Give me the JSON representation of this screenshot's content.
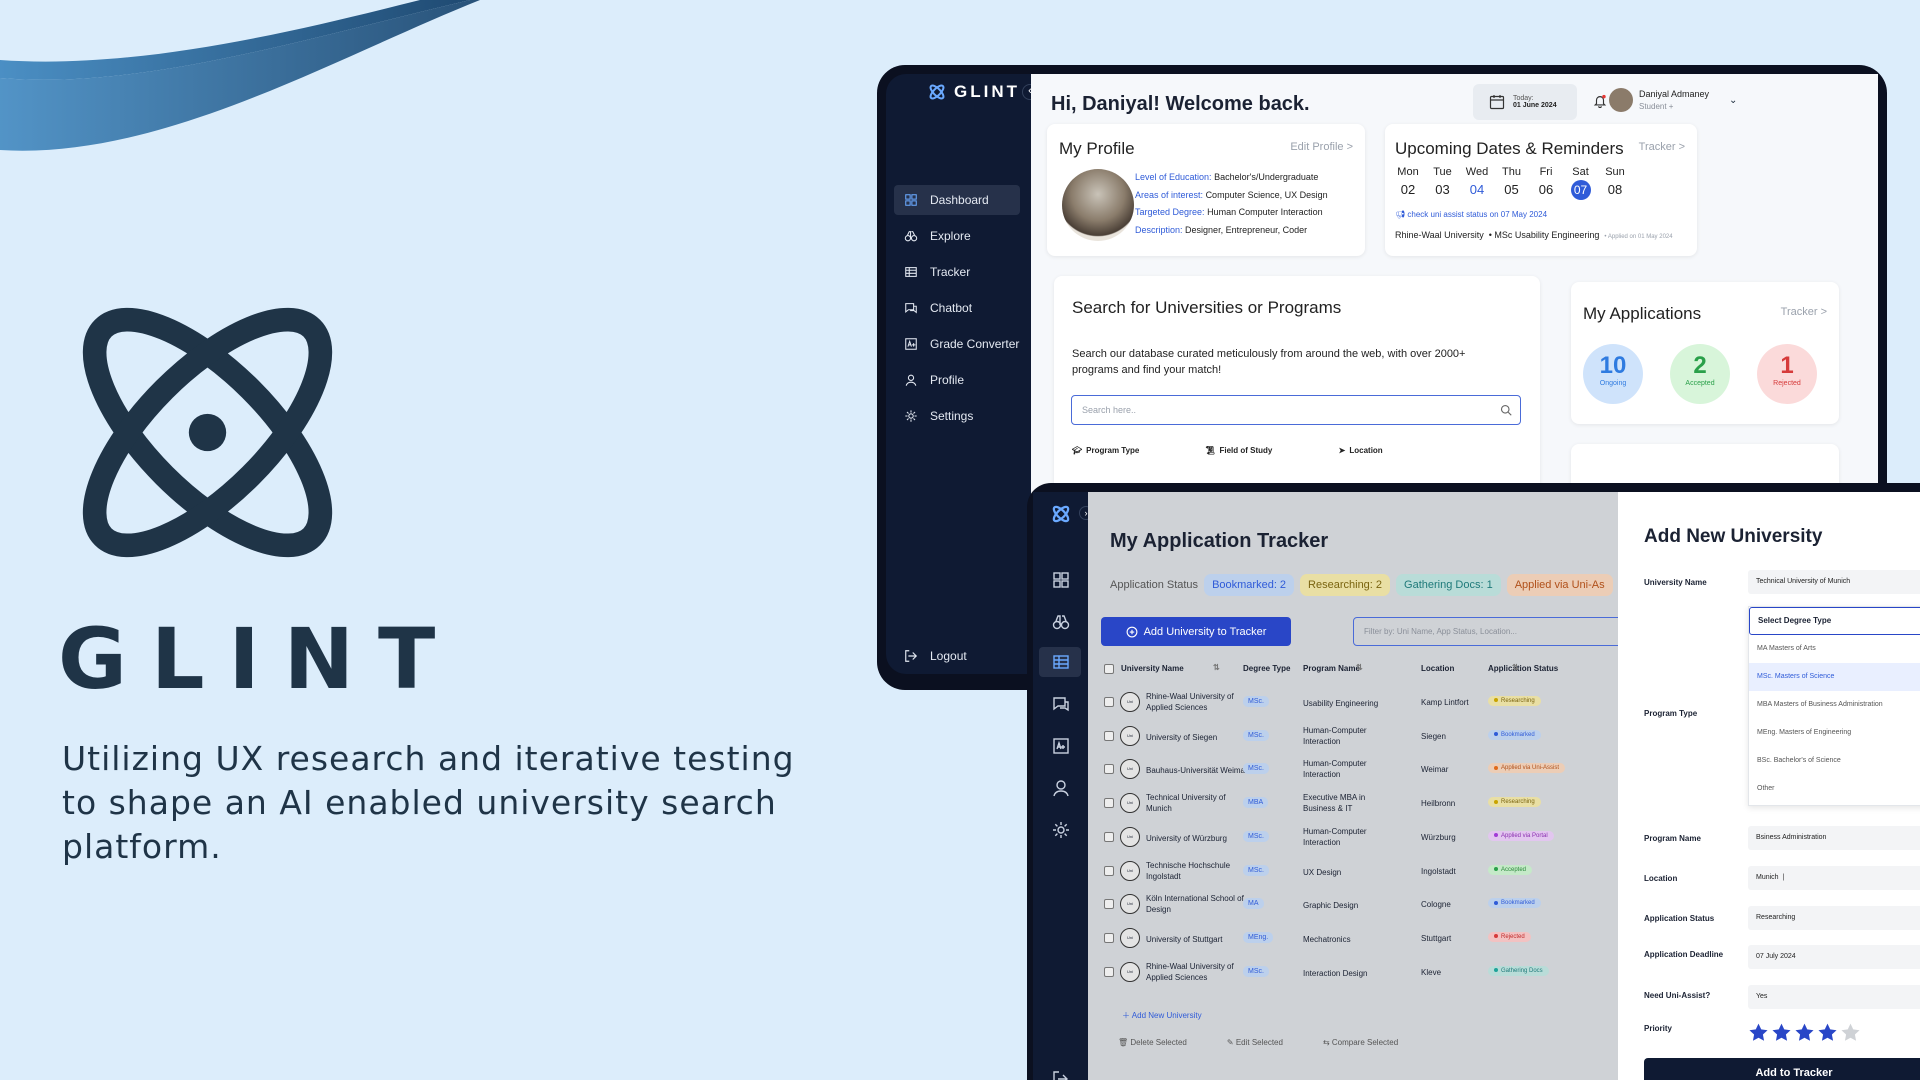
{
  "brand": {
    "name": "GLINT",
    "tagline": "Utilizing UX research and iterative testing to shape an AI enabled university search platform.",
    "color": "#1f3447"
  },
  "dashboard": {
    "logo": "GLINT",
    "nav": [
      {
        "label": "Dashboard",
        "icon": "grid-icon",
        "active": true
      },
      {
        "label": "Explore",
        "icon": "binoculars-icon"
      },
      {
        "label": "Tracker",
        "icon": "table-icon"
      },
      {
        "label": "Chatbot",
        "icon": "chat-icon"
      },
      {
        "label": "Grade Converter",
        "icon": "grade-icon"
      },
      {
        "label": "Profile",
        "icon": "user-icon"
      },
      {
        "label": "Settings",
        "icon": "gear-icon"
      }
    ],
    "logout": "Logout",
    "greeting": "Hi, Daniyal! Welcome back.",
    "today_label": "Today:",
    "today_date": "01 June 2024",
    "user_name": "Daniyal Admaney",
    "user_role": "Student +",
    "profile": {
      "title": "My Profile",
      "edit": "Edit Profile >",
      "rows": [
        {
          "k": "Level of Education:",
          "v": "Bachelor's/Undergraduate"
        },
        {
          "k": "Areas of interest:",
          "v": "Computer Science, UX Design"
        },
        {
          "k": "Targeted Degree:",
          "v": "Human Computer Interaction"
        },
        {
          "k": "Description:",
          "v": "Designer, Entrepreneur, Coder"
        }
      ]
    },
    "dates": {
      "title": "Upcoming Dates & Reminders",
      "link": "Tracker >",
      "days": [
        {
          "d": "Mon",
          "n": "02"
        },
        {
          "d": "Tue",
          "n": "03"
        },
        {
          "d": "Wed",
          "n": "04"
        },
        {
          "d": "Thu",
          "n": "05"
        },
        {
          "d": "Fri",
          "n": "06"
        },
        {
          "d": "Sat",
          "n": "07"
        },
        {
          "d": "Sun",
          "n": "08"
        }
      ],
      "reminder": "check uni assist status on 07 May 2024",
      "uni": "Rhine-Waal University",
      "program": "MSc Usability Engineering",
      "applied": "Applied on 01 May 2024"
    },
    "search": {
      "title": "Search for Universities or Programs",
      "desc": "Search our database curated meticulously from around the web, with over 2000+ programs and find your match!",
      "placeholder": "Search here..",
      "filters": [
        "Program Type",
        "Field of Study",
        "Location"
      ]
    },
    "apps": {
      "title": "My Applications",
      "link": "Tracker >",
      "stats": [
        {
          "value": "10",
          "label": "Ongoing",
          "color": "#2f7be0",
          "bg": "#cfe3fb"
        },
        {
          "value": "2",
          "label": "Accepted",
          "color": "#2aa04a",
          "bg": "#d8f5da"
        },
        {
          "value": "1",
          "label": "Rejected",
          "color": "#d63a3a",
          "bg": "#fbdada"
        }
      ]
    }
  },
  "tracker": {
    "title": "My Application Tracker",
    "status_label": "Application Status",
    "pills": [
      {
        "label": "Bookmarked: 2",
        "color": "#2f5bd8",
        "bg": "#bcd0ec"
      },
      {
        "label": "Researching: 2",
        "color": "#7a6410",
        "bg": "#e9dfa4"
      },
      {
        "label": "Gathering Docs: 1",
        "color": "#1f7a7a",
        "bg": "#b9dcd8"
      },
      {
        "label": "Applied via Uni-As",
        "color": "#b0501a",
        "bg": "#eccdb6"
      }
    ],
    "add_button": "Add University to Tracker",
    "filter_placeholder": "Filter by: Uni Name, App Status, Location...",
    "headers": [
      "University Name",
      "Degree Type",
      "Program Name",
      "Location",
      "Application Status"
    ],
    "rows": [
      {
        "uni": [
          "Rhine-Waal University of",
          "Applied Sciences"
        ],
        "deg": "MSc.",
        "prog": [
          "Usability Engineering"
        ],
        "loc": "Kamp Lintfort",
        "status": "Researching"
      },
      {
        "uni": [
          "University of Siegen"
        ],
        "deg": "MSc.",
        "prog": [
          "Human-Computer",
          "Interaction"
        ],
        "loc": "Siegen",
        "status": "Bookmarked"
      },
      {
        "uni": [
          "Bauhaus-Universität Weimar"
        ],
        "deg": "MSc.",
        "prog": [
          "Human-Computer",
          "Interaction"
        ],
        "loc": "Weimar",
        "status": "Applied via Uni-Assist"
      },
      {
        "uni": [
          "Technical University of",
          "Munich"
        ],
        "deg": "MBA",
        "prog": [
          "Executive MBA in",
          "Business & IT"
        ],
        "loc": "Heilbronn",
        "status": "Researching"
      },
      {
        "uni": [
          "University of Würzburg"
        ],
        "deg": "MSc.",
        "prog": [
          "Human-Computer",
          "Interaction"
        ],
        "loc": "Würzburg",
        "status": "Applied via Portal"
      },
      {
        "uni": [
          "Technische Hochschule",
          "Ingolstadt"
        ],
        "deg": "MSc.",
        "prog": [
          "UX Design"
        ],
        "loc": "Ingolstadt",
        "status": "Accepted"
      },
      {
        "uni": [
          "Köln International School of",
          "Design"
        ],
        "deg": "MA",
        "prog": [
          "Graphic Design"
        ],
        "loc": "Cologne",
        "status": "Bookmarked"
      },
      {
        "uni": [
          "University of Stuttgart"
        ],
        "deg": "MEng.",
        "prog": [
          "Mechatronics"
        ],
        "loc": "Stuttgart",
        "status": "Rejected"
      },
      {
        "uni": [
          "Rhine-Waal University of",
          "Applied Sciences"
        ],
        "deg": "MSc.",
        "prog": [
          "Interaction Design"
        ],
        "loc": "Kleve",
        "status": "Gathering Docs"
      }
    ],
    "status_colors": {
      "Researching": {
        "bg": "#e9dfa4",
        "fg": "#7a6410",
        "dot": "#c9a400"
      },
      "Bookmarked": {
        "bg": "#bcd0ec",
        "fg": "#2f5bd8",
        "dot": "#2f5bd8"
      },
      "Applied via Uni-Assist": {
        "bg": "#eccdb6",
        "fg": "#b0501a",
        "dot": "#e06a1a"
      },
      "Applied via Portal": {
        "bg": "#e2c6ef",
        "fg": "#8b2fb0",
        "dot": "#a23ad6"
      },
      "Accepted": {
        "bg": "#c5e9c8",
        "fg": "#2a8a3a",
        "dot": "#2aa04a"
      },
      "Rejected": {
        "bg": "#f2c2c2",
        "fg": "#c02a2a",
        "dot": "#d63a3a"
      },
      "Gathering Docs": {
        "bg": "#b9dcd8",
        "fg": "#1f7a7a",
        "dot": "#1fa39a"
      }
    },
    "add_new": "Add New University",
    "actions": [
      "Delete Selected",
      "Edit Selected",
      "Compare Selected"
    ],
    "uni_logo_text": "Uni"
  },
  "add_form": {
    "title": "Add New University",
    "uni_label": "University Name",
    "uni_value": "Technical University of Munich",
    "degree_select": "Select Degree Type",
    "degree_options": [
      "MA Masters of Arts",
      "MSc. Masters of Science",
      "MBA Masters of Business Administration",
      "MEng. Masters of Engineering",
      "BSc. Bachelor's of Science",
      "Other"
    ],
    "program_type_label": "Program Type",
    "program_name_label": "Program Name",
    "program_name_value": "Bsiness Administration",
    "location_label": "Location",
    "location_value": "Munich",
    "status_label": "Application Status",
    "status_value": "Researching",
    "deadline_label": "Application Deadline",
    "deadline_value": "07 July 2024",
    "uni_assist_label": "Need Uni-Assist?",
    "uni_assist_value": "Yes",
    "priority_label": "Priority",
    "priority_stars": 4,
    "priority_max": 5,
    "submit": "Add to Tracker"
  }
}
